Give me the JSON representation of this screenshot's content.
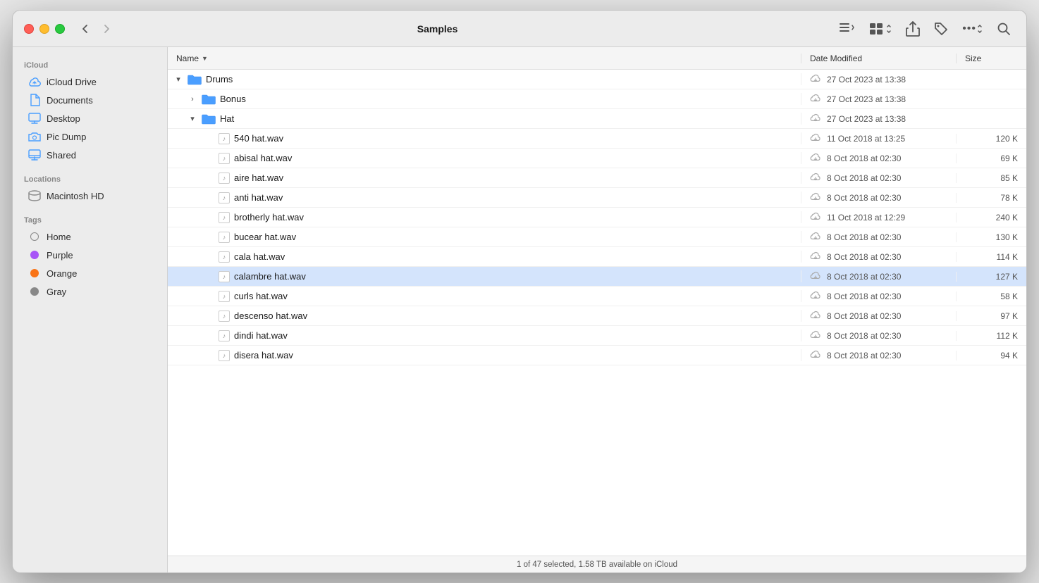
{
  "window": {
    "title": "Samples"
  },
  "titlebar": {
    "back_label": "‹",
    "forward_label": "›",
    "list_view_label": "≡",
    "grid_view_label": "⊞",
    "share_label": "⬆",
    "tag_label": "🏷",
    "more_label": "•••",
    "search_label": "🔍"
  },
  "sidebar": {
    "icloud_section": "iCloud",
    "locations_section": "Locations",
    "tags_section": "Tags",
    "items": [
      {
        "id": "icloud-drive",
        "label": "iCloud Drive",
        "icon": "icloud"
      },
      {
        "id": "documents",
        "label": "Documents",
        "icon": "document"
      },
      {
        "id": "desktop",
        "label": "Desktop",
        "icon": "desktop"
      },
      {
        "id": "pic-dump",
        "label": "Pic Dump",
        "icon": "folder"
      },
      {
        "id": "shared",
        "label": "Shared",
        "icon": "shared"
      }
    ],
    "locations": [
      {
        "id": "macintosh-hd",
        "label": "Macintosh HD",
        "icon": "drive"
      }
    ],
    "tags": [
      {
        "id": "home",
        "label": "Home",
        "color": "transparent",
        "border": "#888"
      },
      {
        "id": "purple",
        "label": "Purple",
        "color": "#a855f7",
        "border": "#a855f7"
      },
      {
        "id": "orange",
        "label": "Orange",
        "color": "#f97316",
        "border": "#f97316"
      },
      {
        "id": "gray",
        "label": "Gray",
        "color": "#888",
        "border": "#888"
      }
    ]
  },
  "columns": {
    "name": "Name",
    "date": "Date Modified",
    "size": "Size"
  },
  "files": [
    {
      "id": "drums",
      "name": "Drums",
      "type": "folder",
      "expanded": true,
      "indent": 0,
      "date": "27 Oct 2023 at 13:38",
      "size": "",
      "disclosure": "▾"
    },
    {
      "id": "bonus",
      "name": "Bonus",
      "type": "folder",
      "expanded": false,
      "indent": 1,
      "date": "27 Oct 2023 at 13:38",
      "size": "",
      "disclosure": "›"
    },
    {
      "id": "hat",
      "name": "Hat",
      "type": "folder",
      "expanded": true,
      "indent": 1,
      "date": "27 Oct 2023 at 13:38",
      "size": "",
      "disclosure": "▾"
    },
    {
      "id": "540hat",
      "name": "540 hat.wav",
      "type": "audio",
      "indent": 2,
      "date": "11 Oct 2018 at 13:25",
      "size": "120 K",
      "disclosure": ""
    },
    {
      "id": "abisalhat",
      "name": "abisal hat.wav",
      "type": "audio",
      "indent": 2,
      "date": "8 Oct 2018 at 02:30",
      "size": "69 K",
      "disclosure": ""
    },
    {
      "id": "airehat",
      "name": "aire hat.wav",
      "type": "audio",
      "indent": 2,
      "date": "8 Oct 2018 at 02:30",
      "size": "85 K",
      "disclosure": ""
    },
    {
      "id": "antihat",
      "name": "anti hat.wav",
      "type": "audio",
      "indent": 2,
      "date": "8 Oct 2018 at 02:30",
      "size": "78 K",
      "disclosure": ""
    },
    {
      "id": "brotherlyhat",
      "name": "brotherly hat.wav",
      "type": "audio",
      "indent": 2,
      "date": "11 Oct 2018 at 12:29",
      "size": "240 K",
      "disclosure": ""
    },
    {
      "id": "bucearhat",
      "name": "bucear hat.wav",
      "type": "audio",
      "indent": 2,
      "date": "8 Oct 2018 at 02:30",
      "size": "130 K",
      "disclosure": ""
    },
    {
      "id": "calahat",
      "name": "cala hat.wav",
      "type": "audio",
      "indent": 2,
      "date": "8 Oct 2018 at 02:30",
      "size": "114 K",
      "disclosure": ""
    },
    {
      "id": "calambrehat",
      "name": "calambre hat.wav",
      "type": "audio",
      "indent": 2,
      "date": "8 Oct 2018 at 02:30",
      "size": "127 K",
      "disclosure": ""
    },
    {
      "id": "curlshat",
      "name": "curls hat.wav",
      "type": "audio",
      "indent": 2,
      "date": "8 Oct 2018 at 02:30",
      "size": "58 K",
      "disclosure": ""
    },
    {
      "id": "descensohat",
      "name": "descenso hat.wav",
      "type": "audio",
      "indent": 2,
      "date": "8 Oct 2018 at 02:30",
      "size": "97 K",
      "disclosure": ""
    },
    {
      "id": "dindihat",
      "name": "dindi hat.wav",
      "type": "audio",
      "indent": 2,
      "date": "8 Oct 2018 at 02:30",
      "size": "112 K",
      "disclosure": ""
    },
    {
      "id": "diserahat",
      "name": "disera hat.wav",
      "type": "audio",
      "indent": 2,
      "date": "8 Oct 2018 at 02:30",
      "size": "94 K",
      "disclosure": ""
    }
  ],
  "status": "1 of 47 selected, 1.58 TB available on iCloud"
}
